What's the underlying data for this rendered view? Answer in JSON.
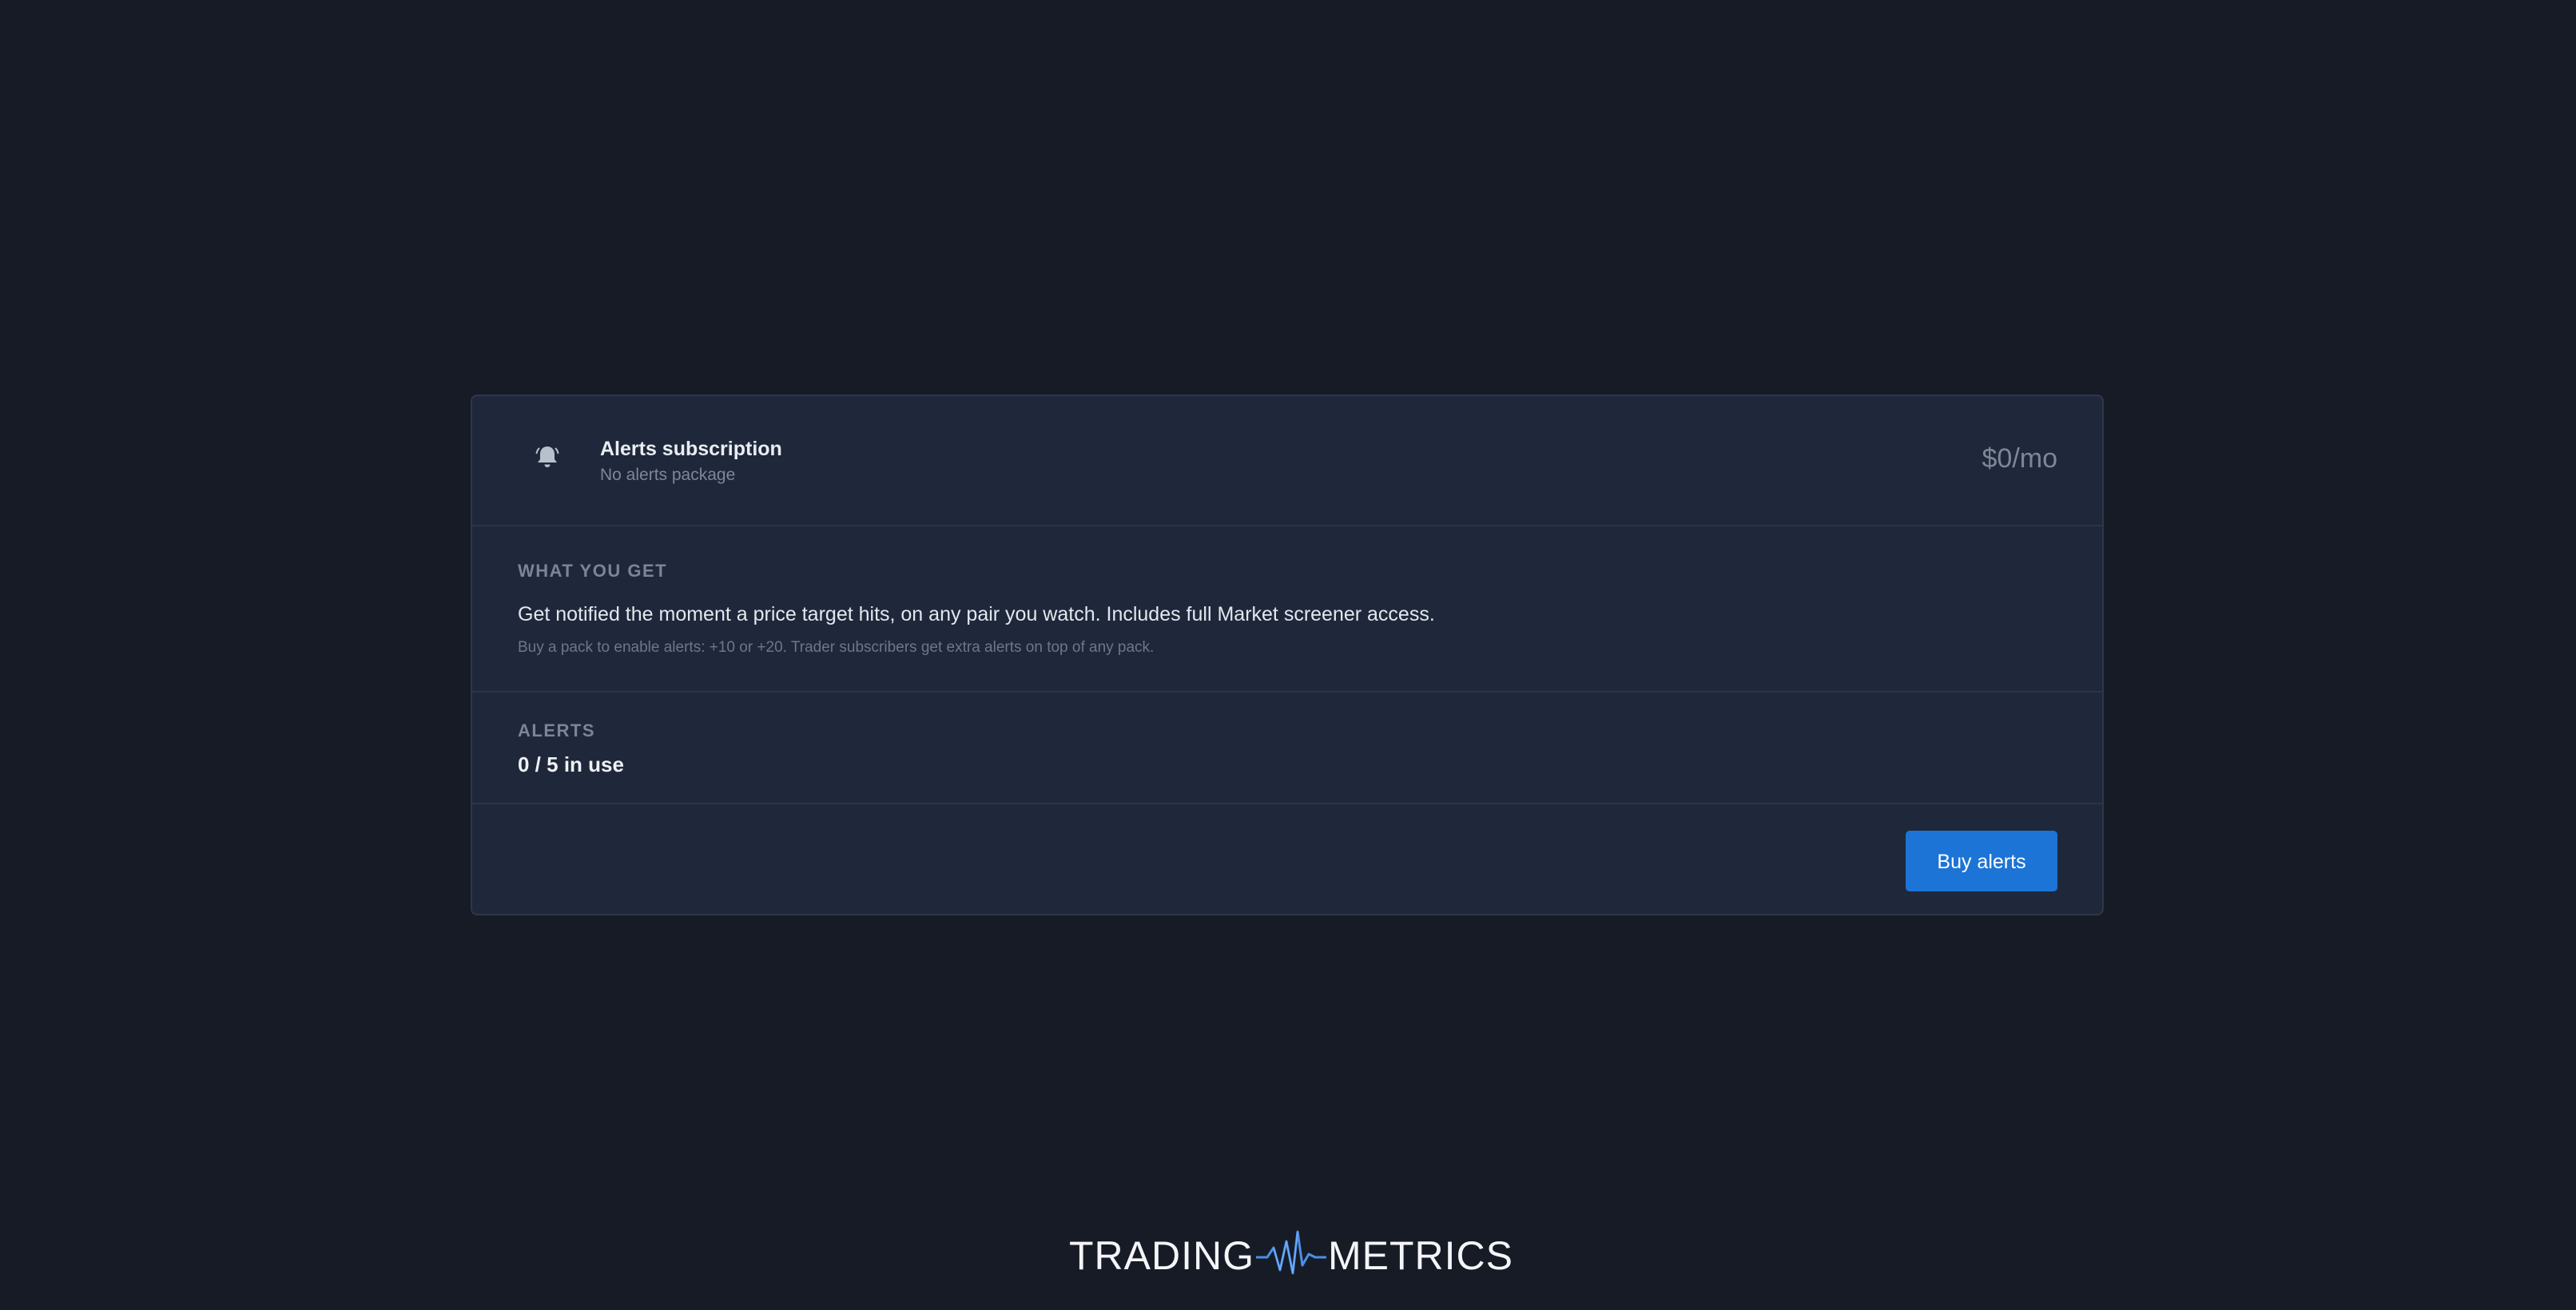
{
  "subscription": {
    "title": "Alerts subscription",
    "subtitle": "No alerts package",
    "price": "$0/mo",
    "icon": "bell-icon"
  },
  "what_you_get": {
    "heading": "WHAT YOU GET",
    "description": "Get notified the moment a price target hits, on any pair you watch. Includes full Market screener access.",
    "note": "Buy a pack to enable alerts: +10 or +20. Trader subscribers get extra alerts on top of any pack."
  },
  "alerts": {
    "heading": "ALERTS",
    "usage": "0 / 5 in use",
    "used": 0,
    "limit": 5
  },
  "actions": {
    "buy_label": "Buy alerts"
  },
  "brand": {
    "left": "TRADING",
    "right": "METRICS",
    "accent_color": "#4a8fe8"
  },
  "colors": {
    "background": "#171b25",
    "card": "#1f283a",
    "button": "#1c74d6"
  }
}
